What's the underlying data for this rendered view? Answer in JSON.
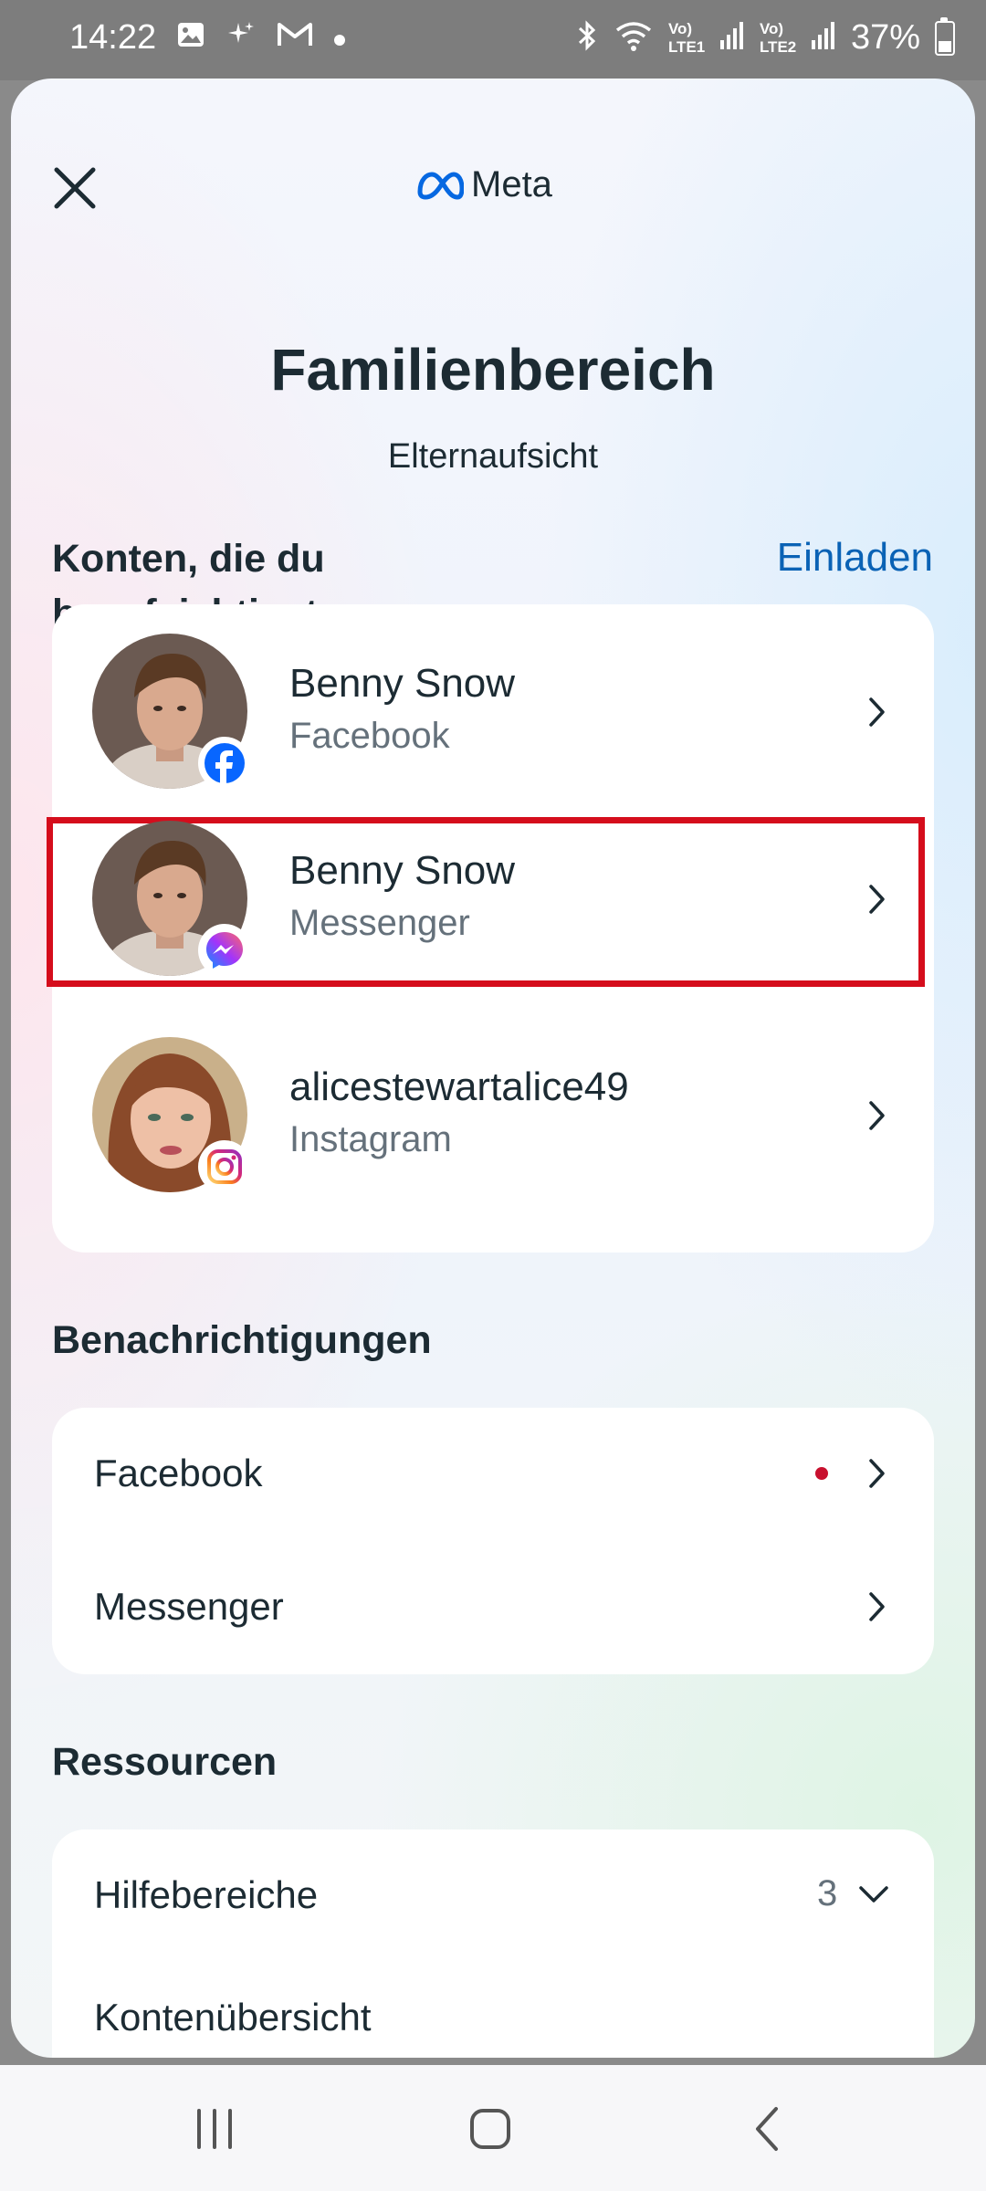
{
  "status_bar": {
    "time": "14:22",
    "left_icons": [
      "gallery-icon",
      "sparkle-icon",
      "gmail-icon",
      "dot-icon"
    ],
    "sim1": "Vo) LTE1",
    "sim2": "Vo) LTE2",
    "battery": "37%"
  },
  "header": {
    "brand": "Meta",
    "title": "Familienbereich",
    "subtitle": "Elternaufsicht"
  },
  "accounts_section": {
    "heading_line1": "Konten, die du",
    "heading_line2": "beaufsichtigst",
    "invite_label": "Einladen",
    "items": [
      {
        "name": "Benny Snow",
        "app": "Facebook",
        "badge": "facebook-icon"
      },
      {
        "name": "Benny Snow",
        "app": "Messenger",
        "badge": "messenger-icon",
        "highlighted": true
      },
      {
        "name": "alicestewartalice49",
        "app": "Instagram",
        "badge": "instagram-icon"
      }
    ]
  },
  "notifications_section": {
    "heading": "Benachrichtigungen",
    "items": [
      {
        "label": "Facebook",
        "unread": true
      },
      {
        "label": "Messenger",
        "unread": false
      }
    ]
  },
  "resources_section": {
    "heading": "Ressourcen",
    "items": [
      {
        "label": "Hilfebereiche",
        "count": "3"
      },
      {
        "label": "Kontenübersicht"
      }
    ]
  },
  "colors": {
    "accent": "#0a62b5",
    "text": "#1c2b33",
    "secondary_text": "#65717b",
    "highlight": "#d50d1c",
    "unread_dot": "#c8102e"
  }
}
